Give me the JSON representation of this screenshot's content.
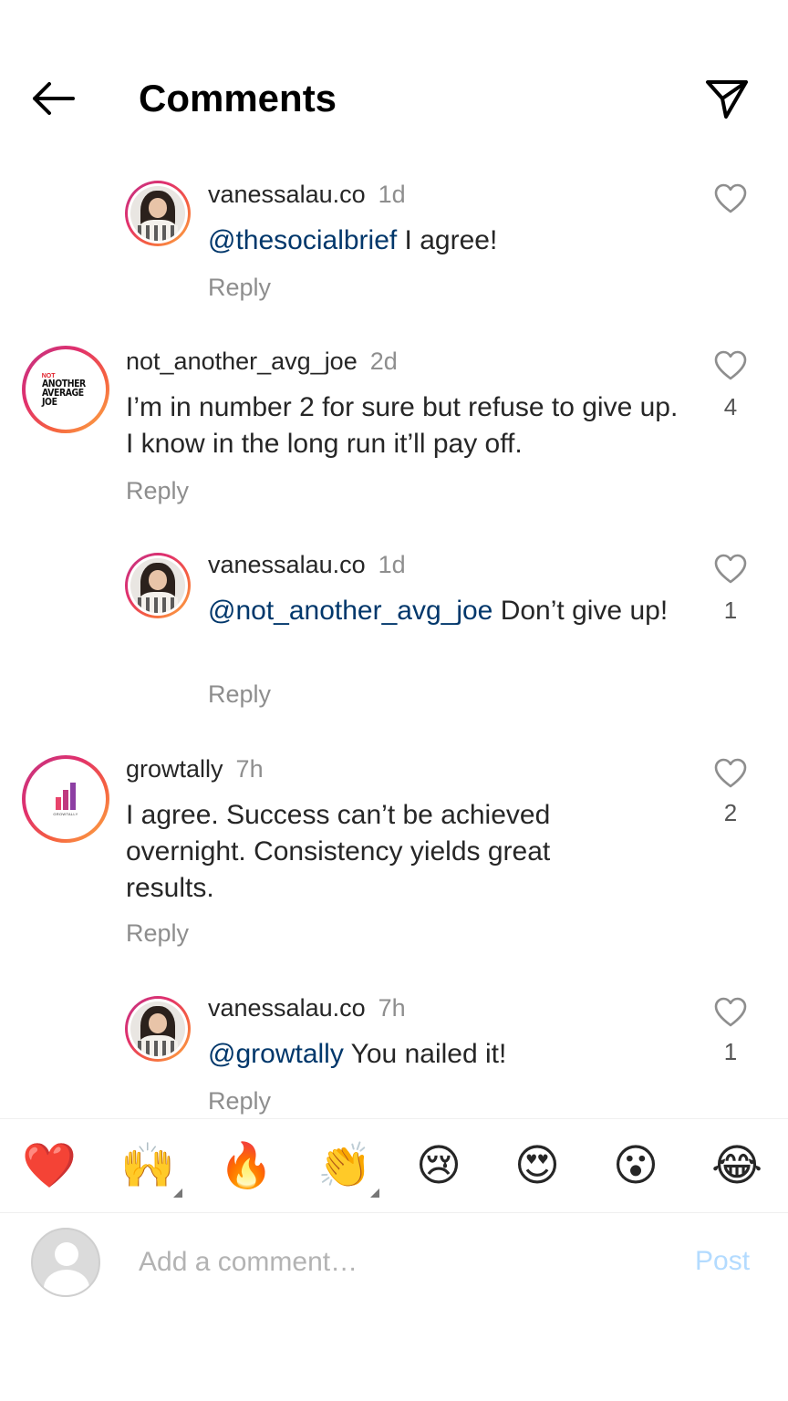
{
  "header": {
    "title": "Comments"
  },
  "comments": [
    {
      "username": "vanessalau.co",
      "time": "1d",
      "mention": "@thesocialbrief",
      "text": " I agree!",
      "reply": "Reply",
      "likes": ""
    },
    {
      "username": "not_another_avg_joe",
      "time": "2d",
      "mention": "",
      "text": "I’m in number 2 for sure but refuse to give up. I know in the long run it’ll pay off.",
      "reply": "Reply",
      "likes": "4",
      "avatar": {
        "not": "NOT",
        "line1": "ANOTHER",
        "line2": "AVERAGE",
        "line3": "JOE"
      }
    },
    {
      "username": "vanessalau.co",
      "time": "1d",
      "mention": "@not_another_avg_joe",
      "text": " Don’t give up!",
      "reply": "Reply",
      "likes": "1"
    },
    {
      "username": "growtally",
      "time": "7h",
      "mention": "",
      "text": "I agree. Success can’t be achieved overnight. Consistency yields great results.",
      "reply": "Reply",
      "likes": "2",
      "avatar": {
        "label": "GROWTALLY"
      }
    },
    {
      "username": "vanessalau.co",
      "time": "7h",
      "mention": "@growtally",
      "text": " You nailed it!",
      "reply": "Reply",
      "likes": "1"
    }
  ],
  "emoji_bar": {
    "emojis": [
      "❤️",
      "🙌",
      "🔥",
      "👏",
      "😢",
      "😍",
      "😮",
      "😂"
    ]
  },
  "composer": {
    "placeholder": "Add a comment…",
    "post_label": "Post"
  },
  "colors": {
    "mention": "#00376b",
    "secondary_text": "#8e8e8e",
    "post_disabled": "#b3dbff"
  },
  "icons": [
    "back-arrow-icon",
    "send-icon",
    "heart-outline-icon",
    "default-avatar-icon"
  ]
}
